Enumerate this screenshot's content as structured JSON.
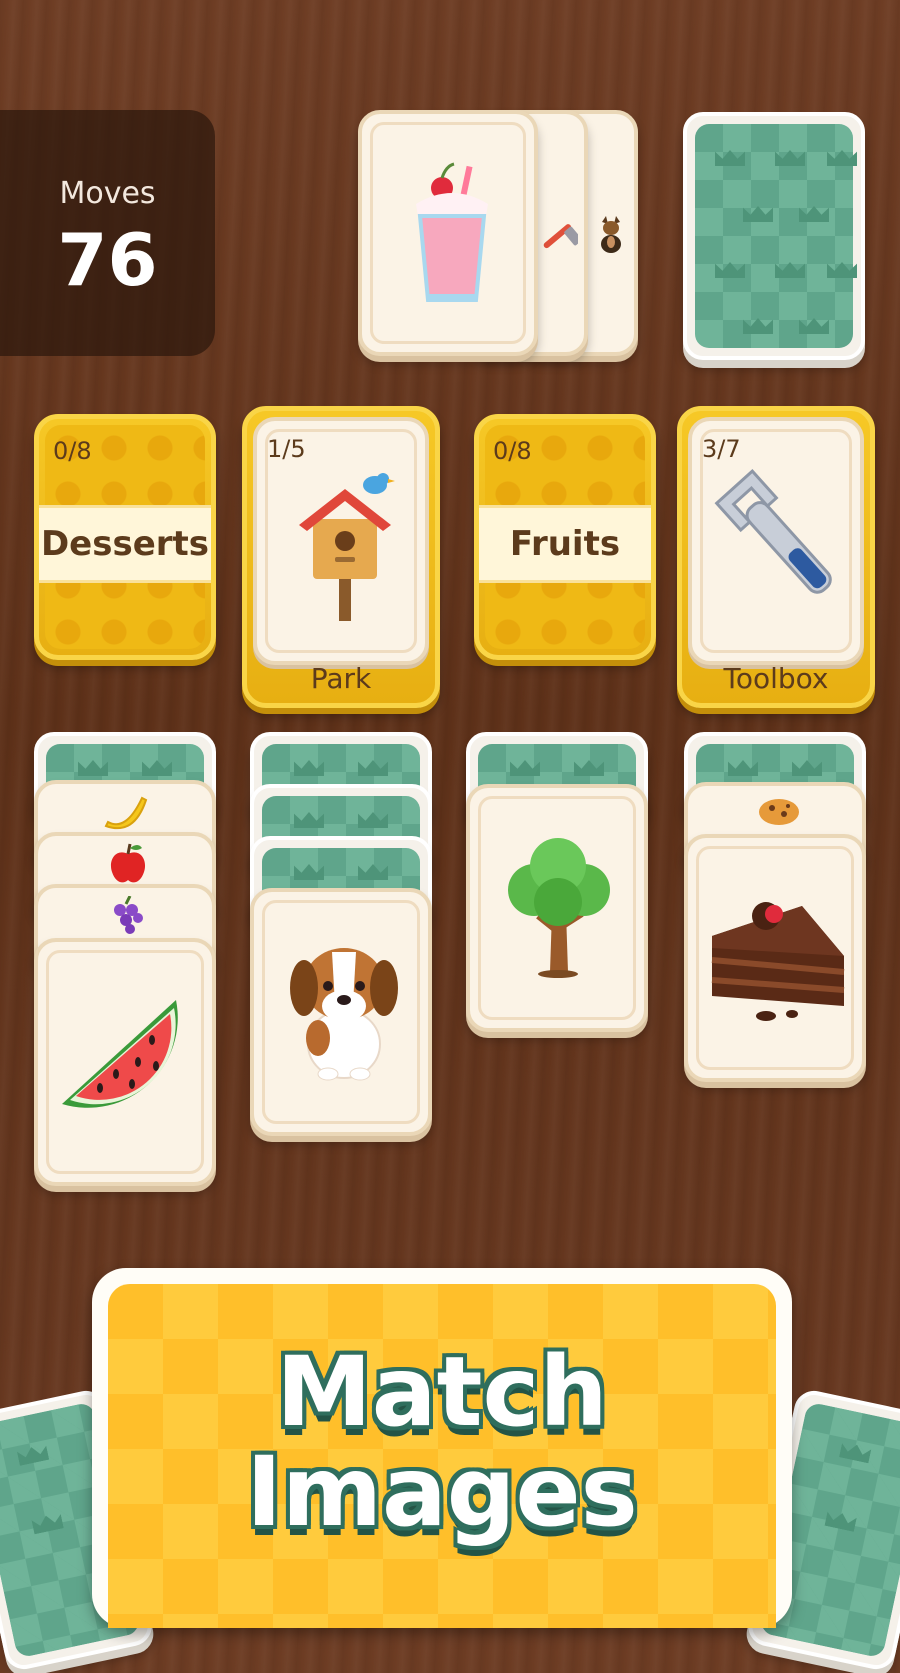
{
  "moves": {
    "label": "Moves",
    "value": "76"
  },
  "categories": [
    {
      "name": "Desserts",
      "progress": "0/8"
    },
    {
      "name": "Park",
      "progress": "1/5",
      "top_card": "birdhouse"
    },
    {
      "name": "Fruits",
      "progress": "0/8"
    },
    {
      "name": "Toolbox",
      "progress": "3/7",
      "top_card": "wrench"
    }
  ],
  "draw_pile": {
    "waste_top": "milkshake",
    "waste_under": [
      "hammer",
      "dog"
    ]
  },
  "tableau": [
    {
      "face_down": 1,
      "face_up": [
        "banana",
        "apple",
        "grapes",
        "watermelon"
      ]
    },
    {
      "face_down": 3,
      "face_up": [
        "puppy"
      ]
    },
    {
      "face_down": 1,
      "face_up": [
        "tree"
      ]
    },
    {
      "face_down": 1,
      "face_up": [
        "cookie",
        "chocolate-cake"
      ]
    }
  ],
  "banner": {
    "line1": "Match",
    "line2": "Images"
  }
}
